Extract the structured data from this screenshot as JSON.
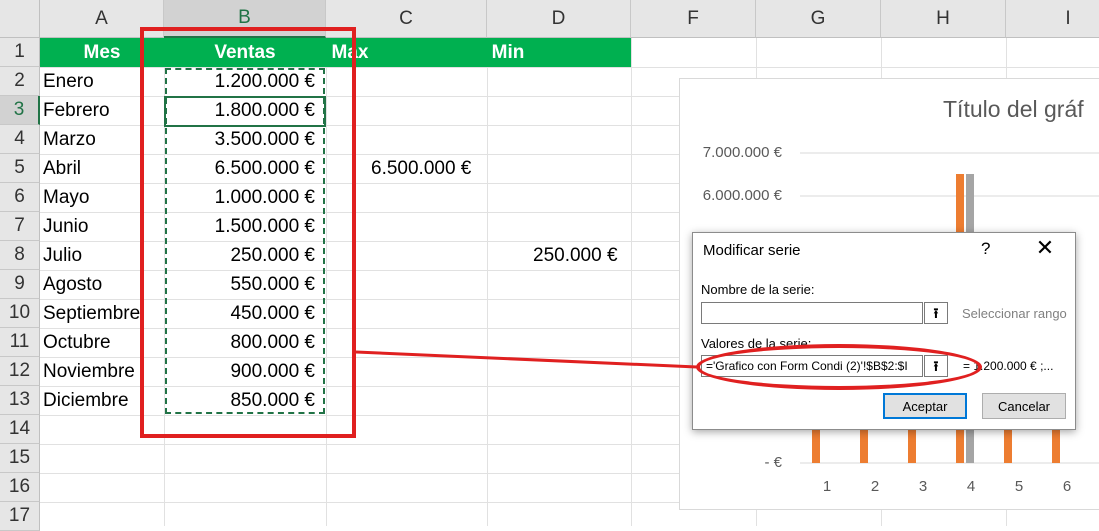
{
  "columns": [
    "A",
    "B",
    "C",
    "D",
    "F",
    "G",
    "H",
    "I"
  ],
  "rows": [
    "1",
    "2",
    "3",
    "4",
    "5",
    "6",
    "7",
    "8",
    "9",
    "10",
    "11",
    "12",
    "13",
    "14",
    "15",
    "16",
    "17"
  ],
  "header": {
    "mes": "Mes",
    "ventas": "Ventas",
    "max": "Max",
    "min": "Min"
  },
  "data": [
    {
      "mes": "Enero",
      "ventas": "1.200.000 €"
    },
    {
      "mes": "Febrero",
      "ventas": "1.800.000 €"
    },
    {
      "mes": "Marzo",
      "ventas": "3.500.000 €"
    },
    {
      "mes": "Abril",
      "ventas": "6.500.000 €"
    },
    {
      "mes": "Mayo",
      "ventas": "1.000.000 €"
    },
    {
      "mes": "Junio",
      "ventas": "1.500.000 €"
    },
    {
      "mes": "Julio",
      "ventas": "250.000 €"
    },
    {
      "mes": "Agosto",
      "ventas": "550.000 €"
    },
    {
      "mes": "Septiembre",
      "ventas": "450.000 €"
    },
    {
      "mes": "Octubre",
      "ventas": "800.000 €"
    },
    {
      "mes": "Noviembre",
      "ventas": "900.000 €"
    },
    {
      "mes": "Diciembre",
      "ventas": "850.000 €"
    }
  ],
  "max_value": "6.500.000 €",
  "min_value": "250.000 €",
  "chart": {
    "title": "Título del gráf",
    "yticks": [
      "7.000.000 €",
      "6.000.000 €",
      "-  €"
    ],
    "xticks": [
      "1",
      "2",
      "3",
      "4",
      "5",
      "6"
    ],
    "colors": {
      "sales": "#ed7d31",
      "max": "#a5a5a5"
    }
  },
  "dialog": {
    "title": "Modificar serie",
    "help": "?",
    "close": "✕",
    "name_label": "Nombre de la serie:",
    "name_value": "",
    "name_hint": "Seleccionar rango",
    "values_label": "Valores de la serie:",
    "values_value": "='Grafico con Form Condi (2)'!$B$2:$I",
    "values_preview": "=   1.200.000 € ;...",
    "ok": "Aceptar",
    "cancel": "Cancelar"
  },
  "colors": {
    "header_green": "#00b050",
    "excel_green": "#217346",
    "annotation_red": "#e02020"
  }
}
